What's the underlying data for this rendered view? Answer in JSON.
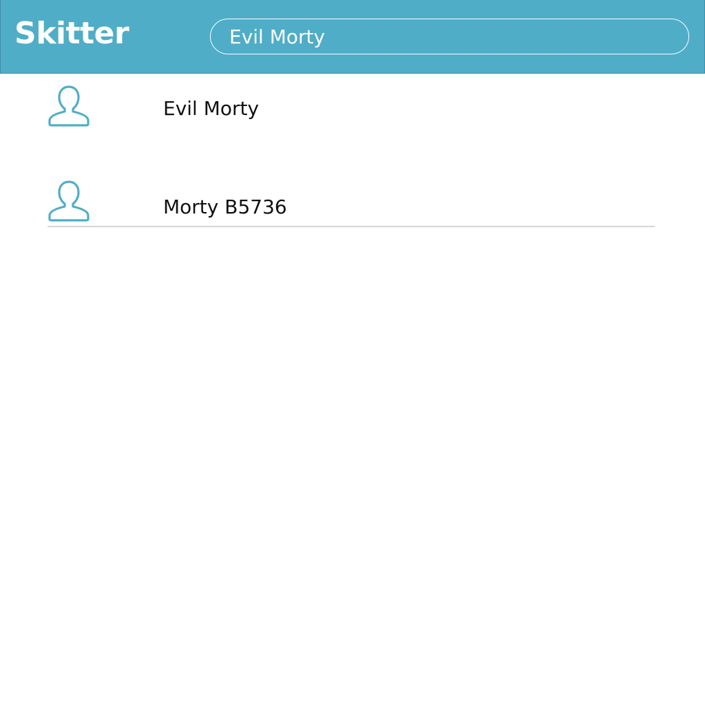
{
  "header": {
    "brand": "Skitter",
    "search_value": "Evil Morty"
  },
  "results": [
    {
      "name": "Evil Morty",
      "icon": "user-icon"
    },
    {
      "name": "Morty B5736",
      "icon": "user-icon"
    }
  ],
  "colors": {
    "accent": "#4fadc8",
    "text": "#111111",
    "divider": "#d5d5d5"
  }
}
